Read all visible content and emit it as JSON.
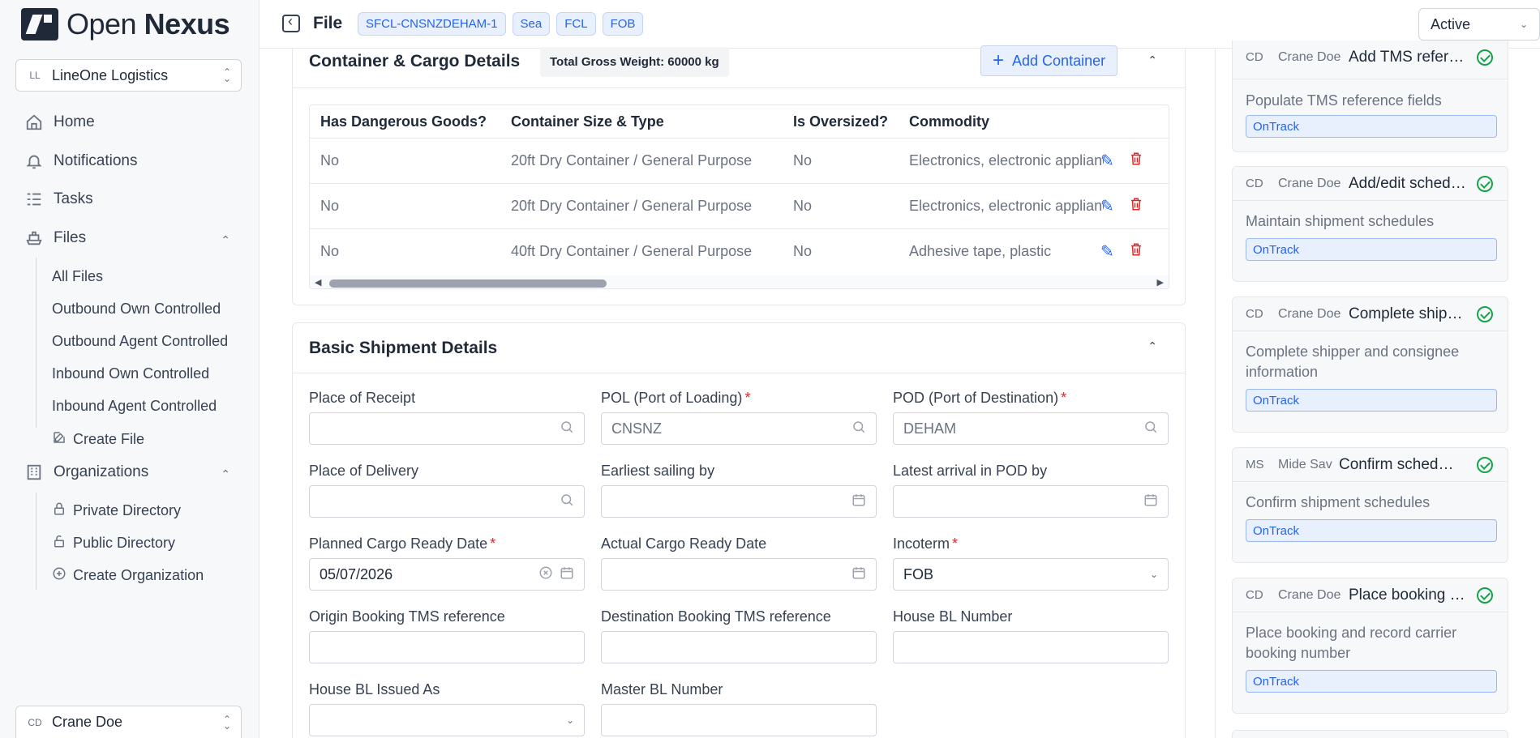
{
  "brand": {
    "name_light": "Open",
    "name_bold": "Nexus"
  },
  "org_switcher": {
    "initials": "LL",
    "label": "LineOne Logistics"
  },
  "nav": {
    "home": "Home",
    "notifications": "Notifications",
    "tasks": "Tasks",
    "files": "Files",
    "files_sub": [
      "All Files",
      "Outbound Own Controlled",
      "Outbound Agent Controlled",
      "Inbound Own Controlled",
      "Inbound Agent Controlled"
    ],
    "create_file": "Create File",
    "organizations": "Organizations",
    "private_directory": "Private Directory",
    "public_directory": "Public Directory",
    "create_organization": "Create Organization"
  },
  "user_switcher": {
    "initials": "CD",
    "label": "Crane Doe"
  },
  "header": {
    "title": "File",
    "tags": [
      "SFCL-CNSNZDEHAM-1",
      "Sea",
      "FCL",
      "FOB"
    ],
    "status": "Active"
  },
  "containers": {
    "title": "Container & Cargo Details",
    "total_weight": "Total Gross Weight: 60000 kg",
    "add_label": "Add Container",
    "columns": [
      "Has Dangerous Goods?",
      "Container Size & Type",
      "Is Oversized?",
      "Commodity"
    ],
    "rows": [
      {
        "dangerous": "No",
        "size_type": "20ft Dry Container / General Purpose",
        "oversized": "No",
        "commodity": "Electronics, electronic appliances, au"
      },
      {
        "dangerous": "No",
        "size_type": "20ft Dry Container / General Purpose",
        "oversized": "No",
        "commodity": "Electronics, electronic appliances, au"
      },
      {
        "dangerous": "No",
        "size_type": "40ft Dry Container / General Purpose",
        "oversized": "No",
        "commodity": "Adhesive tape, plastic"
      }
    ]
  },
  "shipment": {
    "title": "Basic Shipment Details",
    "place_of_receipt": {
      "label": "Place of Receipt",
      "value": ""
    },
    "pol": {
      "label": "POL (Port of Loading)",
      "value": "CNSNZ"
    },
    "pod": {
      "label": "POD (Port of Destination)",
      "value": "DEHAM"
    },
    "place_of_delivery": {
      "label": "Place of Delivery",
      "value": ""
    },
    "earliest_sailing": {
      "label": "Earliest sailing by",
      "value": ""
    },
    "latest_arrival": {
      "label": "Latest arrival in POD by",
      "value": ""
    },
    "planned_ready": {
      "label": "Planned Cargo Ready Date",
      "value": "05/07/2026"
    },
    "actual_ready": {
      "label": "Actual Cargo Ready Date",
      "value": ""
    },
    "incoterm": {
      "label": "Incoterm",
      "value": "FOB"
    },
    "origin_tms": {
      "label": "Origin Booking TMS reference",
      "value": ""
    },
    "dest_tms": {
      "label": "Destination Booking TMS reference",
      "value": ""
    },
    "house_bl": {
      "label": "House BL Number",
      "value": ""
    },
    "house_bl_issued": {
      "label": "House BL Issued As",
      "value": ""
    },
    "master_bl": {
      "label": "Master BL Number",
      "value": ""
    },
    "required_mark": "*"
  },
  "tasks": [
    {
      "initials": "CD",
      "user": "Crane Doe",
      "name": "Add TMS reference fields",
      "desc": "Populate TMS reference fields",
      "status": "OnTrack"
    },
    {
      "initials": "CD",
      "user": "Crane Doe",
      "name": "Add/edit schedules",
      "desc": "Maintain shipment schedules",
      "status": "OnTrack"
    },
    {
      "initials": "CD",
      "user": "Crane Doe",
      "name": "Complete shipper info",
      "desc": "Complete shipper and consignee information",
      "status": "OnTrack"
    },
    {
      "initials": "MS",
      "user": "Mide Sav",
      "name": "Confirm schedules",
      "desc": "Confirm shipment schedules",
      "status": "OnTrack"
    },
    {
      "initials": "CD",
      "user": "Crane Doe",
      "name": "Place booking and record",
      "desc": "Place booking and record carrier booking number",
      "status": "OnTrack"
    }
  ],
  "colors": {
    "accent": "#2563eb",
    "danger": "#dc2626",
    "success": "#16a34a"
  }
}
